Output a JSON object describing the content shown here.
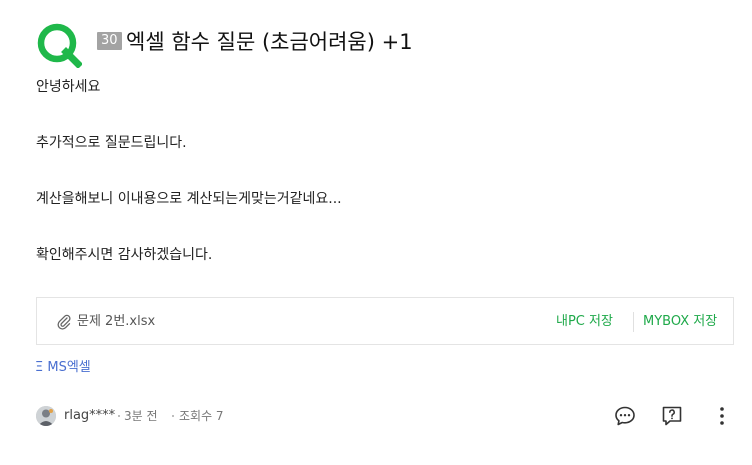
{
  "question": {
    "points": "30",
    "title": "엑셀 함수 질문 (초금어려움) +1",
    "body": [
      "안녕하세요",
      "추가적으로 질문드립니다.",
      "계산을해보니 이내용으로 계산되는게맞는거같네요...",
      "확인해주시면 감사하겠습니다."
    ]
  },
  "attachment": {
    "filename": "문제 2번.xlsx",
    "save_pc_label": "내PC 저장",
    "save_mybox_label": "MYBOX 저장"
  },
  "tag": {
    "label": "Ξ MS엑셀"
  },
  "author": {
    "name": "rlag****",
    "time": "3분 전",
    "views": "조회수 7"
  },
  "icons": {
    "logo": "q-icon",
    "attachment": "paperclip-icon",
    "comment": "comment-icon",
    "report": "question-box-icon",
    "more": "more-vertical-icon"
  },
  "colors": {
    "brand_green": "#1fa94a",
    "tag_blue": "#4a6fd0",
    "points_gray": "#a3a3a3"
  }
}
